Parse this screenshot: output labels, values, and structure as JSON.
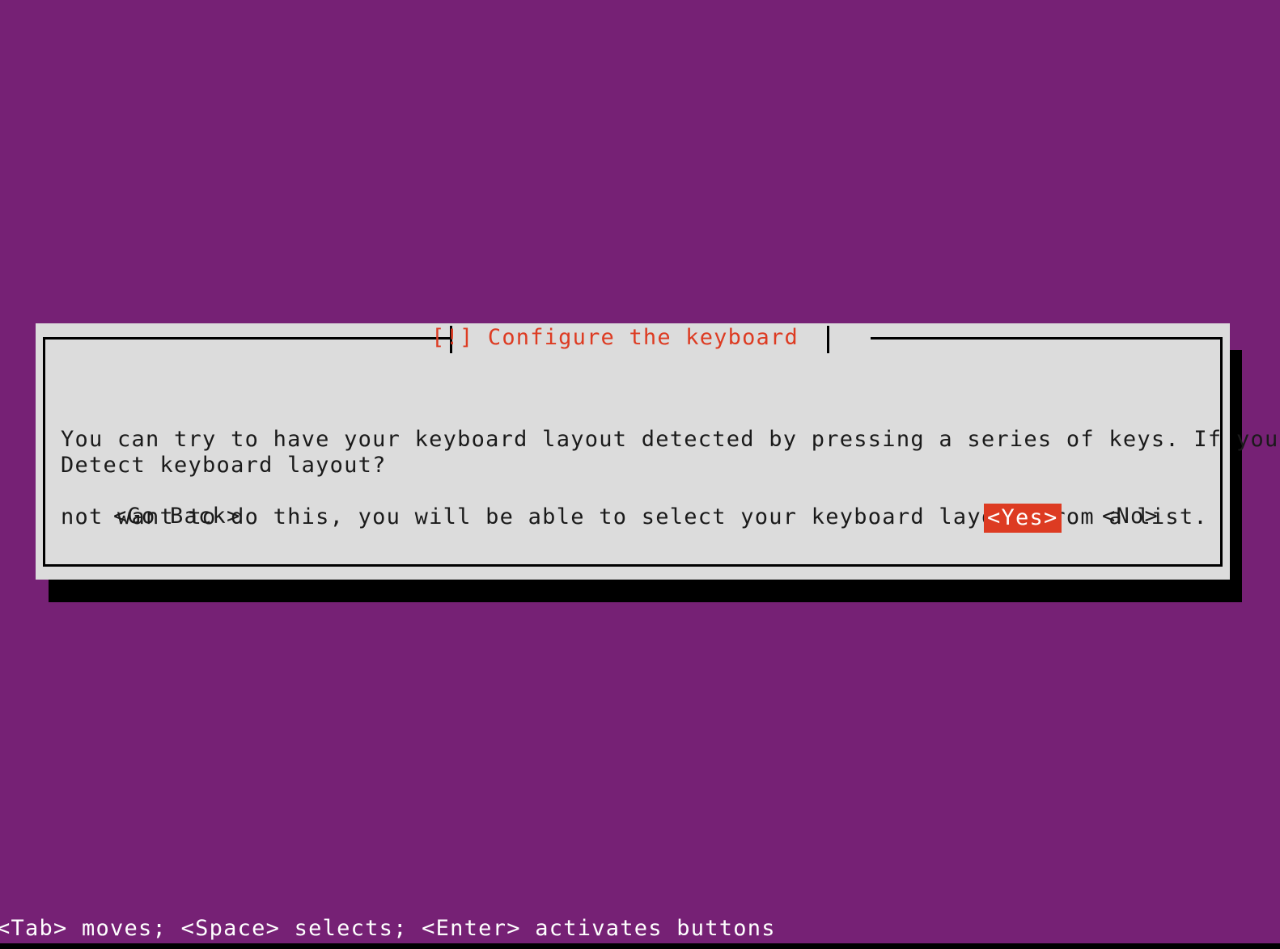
{
  "screen": {
    "background_color": "#762175",
    "foreground_color": "#dcdcdc",
    "accent_color": "#dd3b22",
    "text_color": "#1a1a1a"
  },
  "dialog": {
    "title": "[!] Configure the keyboard",
    "body_lines": [
      "You can try to have your keyboard layout detected by pressing a series of keys. If you do",
      "not want to do this, you will be able to select your keyboard layout from a list."
    ],
    "question": "Detect keyboard layout?",
    "buttons": [
      {
        "label": "<Go Back>",
        "selected": false
      },
      {
        "label": "<Yes>",
        "selected": true
      },
      {
        "label": "<No>",
        "selected": false
      }
    ]
  },
  "status_bar": {
    "text": "<Tab> moves; <Space> selects; <Enter> activates buttons"
  }
}
